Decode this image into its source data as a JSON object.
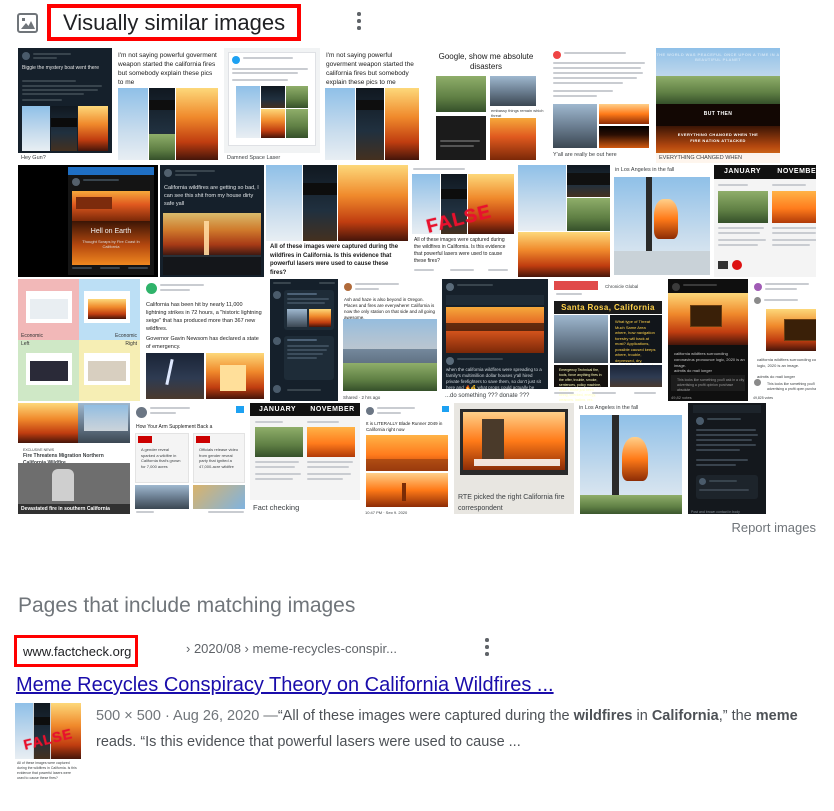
{
  "header": {
    "icon": "image-frame-icon",
    "title": "Visually similar images",
    "menu_icon": "more-options-icon",
    "highlight_color": "#ff0000"
  },
  "image_grid": {
    "report_link": "Report images",
    "rows": [
      {
        "cells": [
          {
            "name": "facebook-mystery-boat-post",
            "style": "fb-dark",
            "caption": "Hey Gun?",
            "meme_text": "Biggie the mystery boat went there"
          },
          {
            "name": "laser-meme-white",
            "style": "meme-white",
            "meme_text": "I'm not saying powerful goverment weapon started the california fires but somebody explain these pics to me"
          },
          {
            "name": "twitter-laser-screenshot",
            "style": "tweet-light",
            "caption": "Damned Space Laser"
          },
          {
            "name": "laser-meme-white-2",
            "style": "meme-white",
            "meme_text": "I'm not saying powerful goverment weapon started the california fires but somebody explain these pics to me"
          },
          {
            "name": "google-absolute-disasters",
            "style": "collage-white",
            "meme_text": "Google, show me absolute disasters"
          },
          {
            "name": "twitter-australia-thread",
            "style": "tweet-light",
            "caption": "Y'all are really be out here"
          },
          {
            "name": "fire-nation-meme",
            "style": "fire-nation",
            "banner_top": "THE WORLD WAS PEACEFUL ONCE UPON A TIME IN A BEAUTIFUL PLANET",
            "banner_mid": "BUT THEN",
            "banner_bot": "EVERYTHING CHANGED WHEN THE FIRE NATION ATTACKED",
            "caption": "EVERYTHING CHANGED WHEN"
          }
        ]
      },
      {
        "cells": [
          {
            "name": "hell-on-earth-post",
            "style": "fb-black",
            "meme_text": "Hell on Earth"
          },
          {
            "name": "twitter-california-wildfires-sky",
            "style": "tweet-dark",
            "meme_text": "California wildfires are getting so bad, I can see this shit from my house dirty safe yall"
          },
          {
            "name": "laser-collage-caption",
            "style": "collage-caption",
            "meme_text": "All of these images were captured during the wildfires in California. Is this evidence that powerful lasers were used to cause these fires?"
          },
          {
            "name": "laser-collage-false",
            "style": "collage-false",
            "stamp": "FALSE",
            "meme_text": "All of these images were captured during the wildfires in California. Is this evidence that powerful lasers were used to cause these fires?"
          },
          {
            "name": "laser-collage-plain",
            "style": "collage-plain"
          },
          {
            "name": "los-angeles-fall-post",
            "style": "tweet-photo",
            "caption": "in Los Angeles in the fall"
          },
          {
            "name": "january-november-compare",
            "style": "jan-nov",
            "col1": "JANUARY",
            "col2": "NOVEMBER"
          }
        ]
      },
      {
        "cells": [
          {
            "name": "four-quadrant-chart",
            "style": "quad-chart",
            "labels": [
              "Economic",
              "Economic",
              "Left",
              "Right"
            ]
          },
          {
            "name": "lightning-strikes-tweet",
            "style": "lightning-tweet",
            "meme_text": "California has been hit by nearly 11,000 lightning strikes in 72 hours, a \"historic lightning seige\" that has produced more than 367 new wildfires.  Governor Gavin Newsom has declared a state of emergency."
          },
          {
            "name": "dark-thread-screenshot",
            "style": "tweet-dark"
          },
          {
            "name": "smoke-neighborhood-post",
            "style": "smoke-photo"
          },
          {
            "name": "donate-firefighters-post",
            "style": "donate-post",
            "caption": "...do something ??? donate ???"
          },
          {
            "name": "santa-rosa-california-meme",
            "style": "santa-rosa",
            "title": "Santa Rosa, California"
          },
          {
            "name": "fire-video-dark",
            "style": "fire-video"
          },
          {
            "name": "instagram-fire-post",
            "style": "insta-fire"
          }
        ]
      },
      {
        "cells": [
          {
            "name": "northern-california-wildfire-news",
            "style": "news-fire",
            "caption": "Fire Threatens Migration Northern California Wildfire"
          },
          {
            "name": "cnn-headline-tweet",
            "style": "cnn-tweet",
            "meme_text": "How Your Arm Supplement Back a"
          },
          {
            "name": "january-november-factcheck",
            "style": "jan-nov-fact",
            "col1": "JANUARY",
            "col2": "NOVEMBER",
            "caption": "Fact checking"
          },
          {
            "name": "blade-runner-2049-tweet",
            "style": "blade-runner",
            "meme_text": "It is LITERALLY Blade Runner 2049 in California right now"
          },
          {
            "name": "rte-correspondent-meme",
            "style": "rte-meme",
            "caption": "RTE picked the right California fire correspondent"
          },
          {
            "name": "los-angeles-fall-photo",
            "style": "tweet-photo",
            "caption": "in Los Angeles in the fall"
          },
          {
            "name": "dark-mobile-thread",
            "style": "mobile-dark"
          }
        ]
      }
    ]
  },
  "pages_section": {
    "title": "Pages that include matching images",
    "result": {
      "url_domain": "www.factcheck.org",
      "url_path": "› 2020/08 › meme-recycles-conspir...",
      "menu_icon": "more-options-icon",
      "title": "Meme Recycles Conspiracy Theory on California Wildfires ...",
      "thumbnail": "meme-thumbnail-false-stamp",
      "snippet": {
        "dimensions": "500 × 500",
        "separator": "·",
        "date": "Aug 26, 2020",
        "dash": "—",
        "part1": "“All of these images were captured during the ",
        "bold1": "wildfires",
        "part2": " in ",
        "bold2": "California",
        "part3": ",” the ",
        "bold3": "meme",
        "part4": " reads. “Is this evidence that powerful lasers were used to cause ..."
      }
    }
  }
}
